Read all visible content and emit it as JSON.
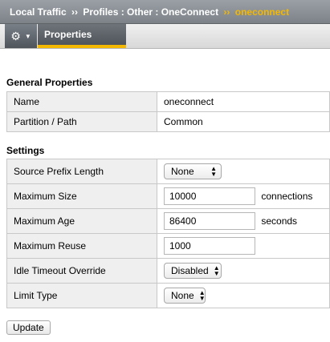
{
  "breadcrumb": {
    "items": [
      "Local Traffic",
      "Profiles : Other : OneConnect"
    ],
    "separator": "››",
    "current": "oneconnect"
  },
  "toolbar": {
    "gear_icon": "gear-icon",
    "tab_label": "Properties"
  },
  "general": {
    "title": "General Properties",
    "rows": [
      {
        "label": "Name",
        "value": "oneconnect"
      },
      {
        "label": "Partition / Path",
        "value": "Common"
      }
    ]
  },
  "settings": {
    "title": "Settings",
    "source_prefix": {
      "label": "Source Prefix Length",
      "value": "None"
    },
    "max_size": {
      "label": "Maximum Size",
      "value": "10000",
      "unit": "connections"
    },
    "max_age": {
      "label": "Maximum Age",
      "value": "86400",
      "unit": "seconds"
    },
    "max_reuse": {
      "label": "Maximum Reuse",
      "value": "1000"
    },
    "idle_timeout": {
      "label": "Idle Timeout Override",
      "value": "Disabled"
    },
    "limit_type": {
      "label": "Limit Type",
      "value": "None"
    }
  },
  "actions": {
    "update_label": "Update"
  },
  "colors": {
    "accent": "#f5b800",
    "header": "#7c8288"
  }
}
